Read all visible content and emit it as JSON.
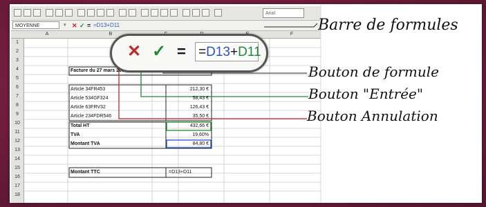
{
  "toolbar": {
    "font_name": "Arial"
  },
  "formula_bar": {
    "name_box": "MOYENNE",
    "cancel_symbol": "✕",
    "enter_symbol": "✓",
    "equal_symbol": "=",
    "formula_value": "=D13+D11"
  },
  "columns": [
    "A",
    "B",
    "C",
    "D",
    "E",
    "F"
  ],
  "rows": [
    "1",
    "2",
    "3",
    "4",
    "5",
    "6",
    "7",
    "8",
    "9",
    "10",
    "11",
    "12",
    "13",
    "14",
    "15",
    "16",
    "17",
    "18"
  ],
  "sheet": {
    "title": "Facture du 27 mars 2003",
    "items": [
      {
        "label": "Article 34FR453",
        "value": "212,30 €"
      },
      {
        "label": "Article 534GF324",
        "value": "58,43 €"
      },
      {
        "label": "Article 63FRV32",
        "value": "126,43 €"
      },
      {
        "label": "Article 234FDR546",
        "value": "35,50 €"
      }
    ],
    "total_ht_label": "Total HT",
    "total_ht_value": "432,66 €",
    "tva_label": "TVA",
    "tva_value": "19,60%",
    "montant_tva_label": "Montant TVA",
    "montant_tva_value": "84,80 €",
    "montant_ttc_label": "Montant TTC",
    "montant_ttc_formula": "=D13+D11"
  },
  "zoom": {
    "cancel": "✕",
    "enter": "✓",
    "equal": "=",
    "formula_prefix": "=",
    "ref1": "D13",
    "plus": "+",
    "ref2": "D11"
  },
  "callouts": {
    "formula_bar": "Barre de formules",
    "formula_button": "Bouton de formule",
    "enter_button": "Bouton \"Entrée\"",
    "cancel_button": "Bouton Annulation"
  },
  "colors": {
    "cancel_red": "#c0282a",
    "enter_green": "#1e8a30",
    "ref_blue": "#2a50c8",
    "background": "#6e1c3c"
  }
}
